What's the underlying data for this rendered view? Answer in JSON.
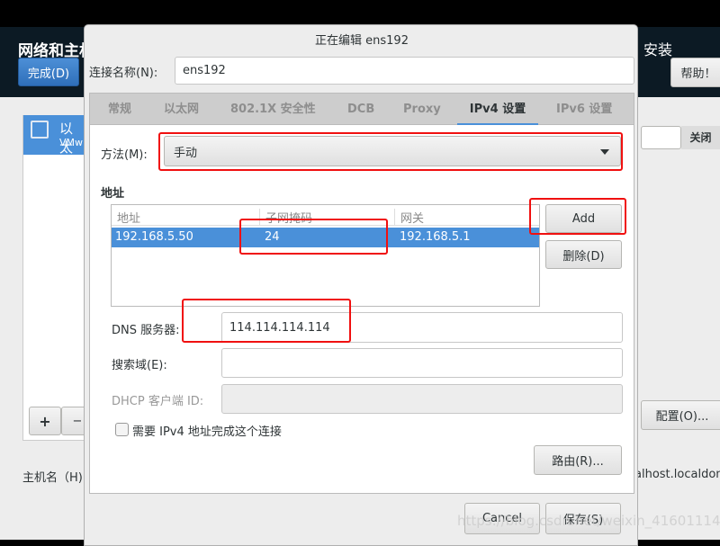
{
  "background": {
    "title": "网络和主机",
    "done_label": "完成(D)",
    "install_label": "安装",
    "help_label": "帮助！",
    "connection_item": {
      "name": "以太",
      "sub": "VMw"
    },
    "toggle_label": "关闭",
    "add_label": "+",
    "remove_label": "−",
    "configure_label": "配置(O)...",
    "hostname_label": "主机名（H)",
    "hostname_value": "alhost.localdoma"
  },
  "dialog": {
    "title": "正在编辑 ens192",
    "conn_name_label": "连接名称(N):",
    "conn_name_value": "ens192",
    "tabs": [
      {
        "label": "常规"
      },
      {
        "label": "以太网"
      },
      {
        "label": "802.1X 安全性"
      },
      {
        "label": "DCB"
      },
      {
        "label": "Proxy"
      },
      {
        "label": "IPv4 设置",
        "active": true
      },
      {
        "label": "IPv6 设置"
      }
    ],
    "method_label": "方法(M):",
    "method_value": "手动",
    "address_section": "地址",
    "table": {
      "headers": [
        "地址",
        "子网掩码",
        "网关"
      ],
      "rows": [
        [
          "192.168.5.50",
          "24",
          "192.168.5.1"
        ]
      ]
    },
    "add_label": "Add",
    "delete_label": "删除(D)",
    "dns_label": "DNS 服务器:",
    "dns_value": "114.114.114.114",
    "search_label": "搜索域(E):",
    "search_value": "",
    "dhcp_label": "DHCP 客户端 ID:",
    "dhcp_value": "",
    "require_ipv4_label": "需要 IPv4 地址完成这个连接",
    "require_ipv4_checked": false,
    "routes_label": "路由(R)...",
    "cancel_label": "Cancel",
    "save_label": "保存(S)"
  },
  "watermark": "https://blog.csdn.net/weixin_41601114",
  "colors": {
    "accent": "#4a90d9",
    "highlight": "#f01010",
    "header_bg": "#0c1a24"
  }
}
